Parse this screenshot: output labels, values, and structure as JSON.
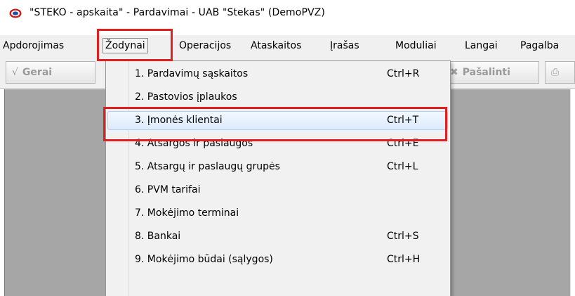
{
  "window": {
    "title": "\"STEKO - apskaita\" - Pardavimai - UAB \"Stekas\" (DemoPVZ)"
  },
  "menubar": {
    "items": [
      "Apdorojimas",
      "Žodynai",
      "Operacijos",
      "Ataskaitos",
      "Įrašas",
      "Moduliai",
      "Langai",
      "Pagalba"
    ],
    "active_index": 1
  },
  "toolbar": {
    "buttons": [
      {
        "label": "Gerai",
        "icon": "check-icon"
      },
      {
        "label": "Pašalinti",
        "icon": "delete-record-icon"
      },
      {
        "label": "",
        "icon": "print-icon"
      }
    ]
  },
  "dropdown": {
    "items": [
      {
        "label": "1. Pardavimų sąskaitos",
        "shortcut": "Ctrl+R"
      },
      {
        "label": "2. Pastovios įplaukos",
        "shortcut": ""
      },
      {
        "label": "3. Įmonės klientai",
        "shortcut": "Ctrl+T"
      },
      {
        "label": "4. Atsargos ir paslaugos",
        "shortcut": "Ctrl+E"
      },
      {
        "label": "5. Atsargų ir paslaugų grupės",
        "shortcut": "Ctrl+L"
      },
      {
        "label": "6. PVM tarifai",
        "shortcut": ""
      },
      {
        "label": "7. Mokėjimo terminai",
        "shortcut": ""
      },
      {
        "label": "8. Bankai",
        "shortcut": "Ctrl+S"
      },
      {
        "label": "9. Mokėjimo būdai (sąlygos)",
        "shortcut": "Ctrl+H"
      }
    ],
    "highlighted_index": 2
  },
  "colors": {
    "callout": "#e02020",
    "workspace": "#a6a6a6",
    "menu_background": "#f0f0f0",
    "highlight": "#dcebfd"
  }
}
